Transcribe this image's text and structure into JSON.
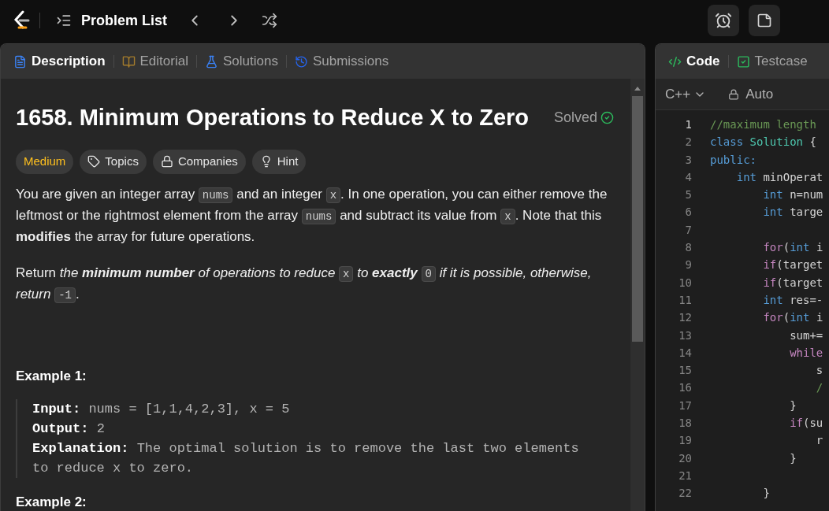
{
  "top_bar": {
    "title": "Problem List"
  },
  "left_tabs": [
    {
      "label": "Description",
      "selected": true,
      "kind": "doc"
    },
    {
      "label": "Editorial",
      "selected": false,
      "kind": "book"
    },
    {
      "label": "Solutions",
      "selected": false,
      "kind": "flask"
    },
    {
      "label": "Submissions",
      "selected": false,
      "kind": "history"
    }
  ],
  "problem": {
    "title": "1658. Minimum Operations to Reduce X to Zero",
    "status": "Solved",
    "solved": true,
    "tags": [
      {
        "label": "Medium",
        "kind": "difficulty"
      },
      {
        "label": "Topics",
        "kind": "tag"
      },
      {
        "label": "Companies",
        "kind": "lock"
      },
      {
        "label": "Hint",
        "kind": "bulb"
      }
    ],
    "paragraphs": [
      [
        {
          "kind": "text",
          "text": "You are given an integer array "
        },
        {
          "kind": "code",
          "text": "nums"
        },
        {
          "kind": "text",
          "text": " and an integer "
        },
        {
          "kind": "code",
          "text": "x"
        },
        {
          "kind": "text",
          "text": ". In one operation, you can either remove the leftmost or the rightmost element from the array "
        },
        {
          "kind": "code",
          "text": "nums"
        },
        {
          "kind": "text",
          "text": " and subtract its value from "
        },
        {
          "kind": "code",
          "text": "x"
        },
        {
          "kind": "text",
          "text": ". Note that this **modifies** the array for future operations."
        }
      ],
      [
        {
          "kind": "text",
          "text": "Return "
        },
        {
          "kind": "italic",
          "text": "the **minimum number** of operations to reduce "
        },
        {
          "kind": "code",
          "text": "x"
        },
        {
          "kind": "italic",
          "text": " to **exactly** "
        },
        {
          "kind": "code",
          "text": "0"
        },
        {
          "kind": "italic",
          "text": " if it is possible, otherwise, return "
        },
        {
          "kind": "code",
          "text": "-1"
        },
        {
          "kind": "text",
          "text": "."
        }
      ]
    ],
    "examples": [
      {
        "heading": "Example 1:",
        "lines": [
          {
            "label": "Input:",
            "value": "nums = [1,1,4,2,3], x = 5"
          },
          {
            "label": "Output:",
            "value": "2"
          },
          {
            "label": "Explanation:",
            "value": "The optimal solution is to remove the last two elements to reduce x to zero."
          }
        ]
      },
      {
        "heading": "Example 2:"
      }
    ]
  },
  "right_tabs": [
    {
      "label": "Code",
      "selected": true,
      "kind": "code"
    },
    {
      "label": "Testcase",
      "selected": false,
      "kind": "check"
    }
  ],
  "editor": {
    "language": "C++",
    "mode": "Auto",
    "lines": [
      {
        "number": "1",
        "tokens": [
          {
            "kind": "comment",
            "text": "//maximum length"
          }
        ]
      },
      {
        "number": "2",
        "tokens": [
          {
            "kind": "keyword",
            "text": "class"
          },
          {
            "kind": "type",
            "text": " Solution"
          },
          {
            "kind": "plain",
            "text": " {"
          }
        ]
      },
      {
        "number": "3",
        "tokens": [
          {
            "kind": "keyword",
            "text": "public:"
          }
        ]
      },
      {
        "number": "4",
        "tokens": [
          {
            "kind": "keyword",
            "text": "    int"
          },
          {
            "kind": "plain",
            "text": " minOperat"
          }
        ]
      },
      {
        "number": "5",
        "tokens": [
          {
            "kind": "keyword",
            "text": "        int"
          },
          {
            "kind": "plain",
            "text": " n=num"
          }
        ]
      },
      {
        "number": "6",
        "tokens": [
          {
            "kind": "keyword",
            "text": "        int"
          },
          {
            "kind": "plain",
            "text": " targe"
          }
        ]
      },
      {
        "number": "7"
      },
      {
        "number": "8",
        "tokens": [
          {
            "kind": "control",
            "text": "        for"
          },
          {
            "kind": "plain",
            "text": "("
          },
          {
            "kind": "keyword",
            "text": "int"
          },
          {
            "kind": "plain",
            "text": " i"
          }
        ]
      },
      {
        "number": "9",
        "tokens": [
          {
            "kind": "control",
            "text": "        if"
          },
          {
            "kind": "plain",
            "text": "(target"
          }
        ]
      },
      {
        "number": "10",
        "tokens": [
          {
            "kind": "control",
            "text": "        if"
          },
          {
            "kind": "plain",
            "text": "(target"
          }
        ]
      },
      {
        "number": "11",
        "tokens": [
          {
            "kind": "keyword",
            "text": "        int"
          },
          {
            "kind": "plain",
            "text": " res=-"
          }
        ]
      },
      {
        "number": "12",
        "tokens": [
          {
            "kind": "control",
            "text": "        for"
          },
          {
            "kind": "plain",
            "text": "("
          },
          {
            "kind": "keyword",
            "text": "int"
          },
          {
            "kind": "plain",
            "text": " i"
          }
        ]
      },
      {
        "number": "13",
        "tokens": [
          {
            "kind": "plain",
            "text": "            sum+="
          }
        ]
      },
      {
        "number": "14",
        "tokens": [
          {
            "kind": "control",
            "text": "            while"
          }
        ]
      },
      {
        "number": "15",
        "tokens": [
          {
            "kind": "plain",
            "text": "                s"
          }
        ]
      },
      {
        "number": "16",
        "tokens": [
          {
            "kind": "comment",
            "text": "                /"
          }
        ]
      },
      {
        "number": "17",
        "tokens": [
          {
            "kind": "plain",
            "text": "            }"
          }
        ]
      },
      {
        "number": "18",
        "tokens": [
          {
            "kind": "control",
            "text": "            if"
          },
          {
            "kind": "plain",
            "text": "(su"
          }
        ]
      },
      {
        "number": "19",
        "tokens": [
          {
            "kind": "plain",
            "text": "                r"
          }
        ]
      },
      {
        "number": "20",
        "tokens": [
          {
            "kind": "plain",
            "text": "            }"
          }
        ]
      },
      {
        "number": "21"
      },
      {
        "number": "22",
        "tokens": [
          {
            "kind": "plain",
            "text": "        }"
          }
        ]
      }
    ]
  }
}
